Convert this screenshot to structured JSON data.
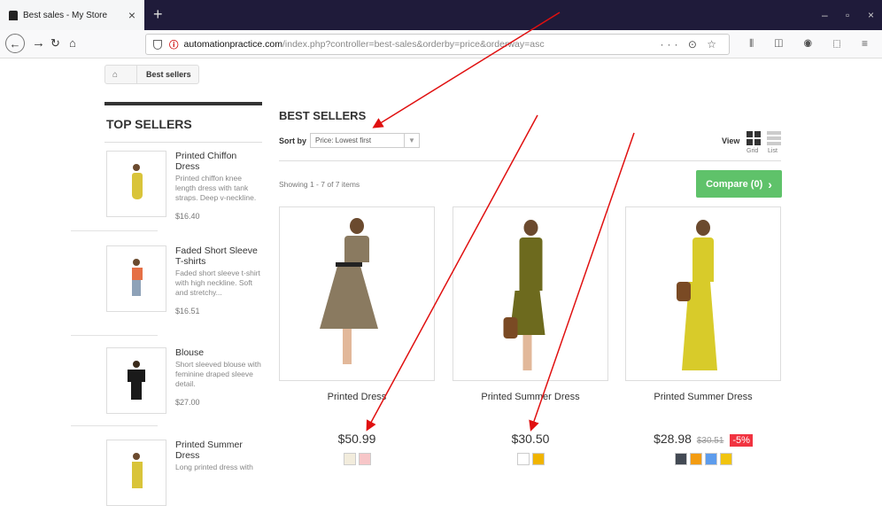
{
  "browser": {
    "tab_title": "Best sales - My Store",
    "tab_close": "×",
    "new_tab": "+",
    "url_host": "automationpractice.com",
    "url_path": "/index.php?controller=best-sales&orderby=price&orderway=asc",
    "url_actions": "··· ⊙ ☆",
    "toolbar_icons": "⫴ ◫ ◉ ⬚ ≡",
    "window_controls": [
      "–",
      "▫",
      "×"
    ]
  },
  "breadcrumb": {
    "current": "Best sellers"
  },
  "sidebar": {
    "title": "TOP SELLERS",
    "items": [
      {
        "name": "Printed Chiffon Dress",
        "desc": "Printed chiffon knee length dress with tank straps. Deep v-neckline.",
        "price": "$16.40",
        "color": "#d9c43a"
      },
      {
        "name": "Faded Short Sleeve T-shirts",
        "desc": "Faded short sleeve t-shirt with high neckline. Soft and stretchy...",
        "price": "$16.51",
        "color": "#e57046"
      },
      {
        "name": "Blouse",
        "desc": "Short sleeved blouse with feminine draped sleeve detail.",
        "price": "$27.00",
        "color": "#1a1a1a"
      },
      {
        "name": "Printed Summer Dress",
        "desc": "Long printed dress with",
        "price": "",
        "color": "#d9c43a"
      }
    ]
  },
  "main": {
    "title": "BEST SELLERS",
    "sort_label": "Sort by",
    "sort_value": "Price: Lowest first",
    "view_label": "View",
    "grid_label": "Grid",
    "list_label": "List",
    "showing": "Showing 1 - 7 of 7 items",
    "compare": "Compare (0)",
    "compare_arrow": "›"
  },
  "products": [
    {
      "name": "Printed Dress",
      "price": "$50.99",
      "old_price": "",
      "discount": "",
      "swatches": [
        "#f2ecdc",
        "#f7c6c8"
      ],
      "dress_color": "#8a7a60"
    },
    {
      "name": "Printed Summer Dress",
      "price": "$30.50",
      "old_price": "",
      "discount": "",
      "swatches": [
        "#ffffff",
        "#f0b400"
      ],
      "dress_color": "#6d6a1e"
    },
    {
      "name": "Printed Summer Dress",
      "price": "$28.98",
      "old_price": "$30.51",
      "discount": "-5%",
      "swatches": [
        "#434a54",
        "#f39c11",
        "#5d9cec",
        "#f1c40f"
      ],
      "dress_color": "#d8cb2a"
    }
  ],
  "colors": {
    "accent_green": "#5fc26a",
    "discount_red": "#f13340",
    "annotation_red": "#e01010"
  }
}
